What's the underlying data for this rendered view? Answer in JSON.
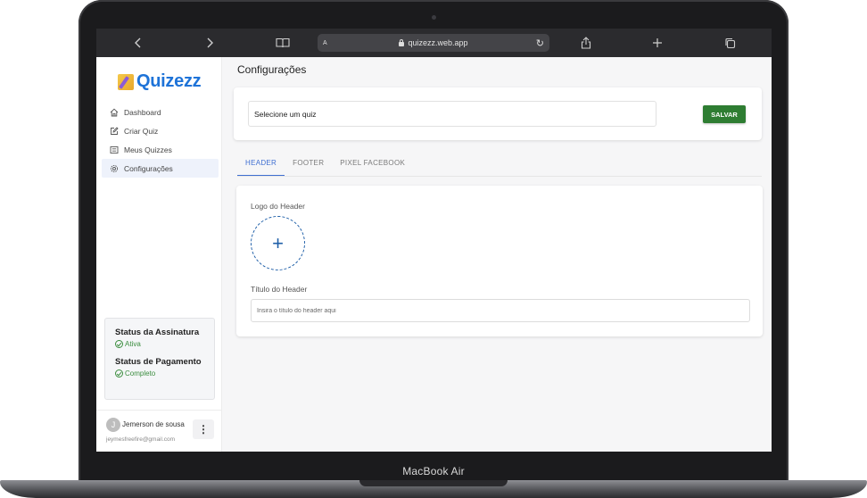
{
  "device": {
    "label": "MacBook Air"
  },
  "browser": {
    "url": "quizezz.web.app",
    "reader_label": "A",
    "back_icon": "chevron-left",
    "forward_icon": "chevron-right",
    "bookmarks_icon": "book",
    "reload_icon": "reload",
    "share_icon": "share",
    "new_tab_icon": "plus",
    "tabs_icon": "tabs"
  },
  "sidebar": {
    "logo_text": "Quizezz",
    "nav": [
      {
        "label": "Dashboard",
        "icon": "home-icon",
        "active": false
      },
      {
        "label": "Criar Quiz",
        "icon": "edit-icon",
        "active": false
      },
      {
        "label": "Meus Quizzes",
        "icon": "list-icon",
        "active": false
      },
      {
        "label": "Configurações",
        "icon": "gear-icon",
        "active": true
      }
    ],
    "status": {
      "subscription_title": "Status da Assinatura",
      "subscription_value": "Ativa",
      "payment_title": "Status de Pagamento",
      "payment_value": "Completo",
      "color": "#3b8d3f"
    },
    "user": {
      "initial": "J",
      "name": "Jemerson de sousa",
      "email": "jeymesfreefire@gmail.com",
      "menu_glyph": "⋮"
    }
  },
  "main": {
    "title": "Configurações",
    "quiz_select_value": "Selecione um quiz",
    "save_label": "SALVAR",
    "save_color": "#2e7d32",
    "tabs": [
      {
        "label": "HEADER",
        "active": true
      },
      {
        "label": "FOOTER",
        "active": false
      },
      {
        "label": "PIXEL FACEBOOK",
        "active": false
      }
    ],
    "accent": "#3f6fd1",
    "logo_label": "Logo do Header",
    "upload_glyph": "+",
    "title_label": "Título do Header",
    "title_placeholder": "Insira o título do header aqui"
  }
}
